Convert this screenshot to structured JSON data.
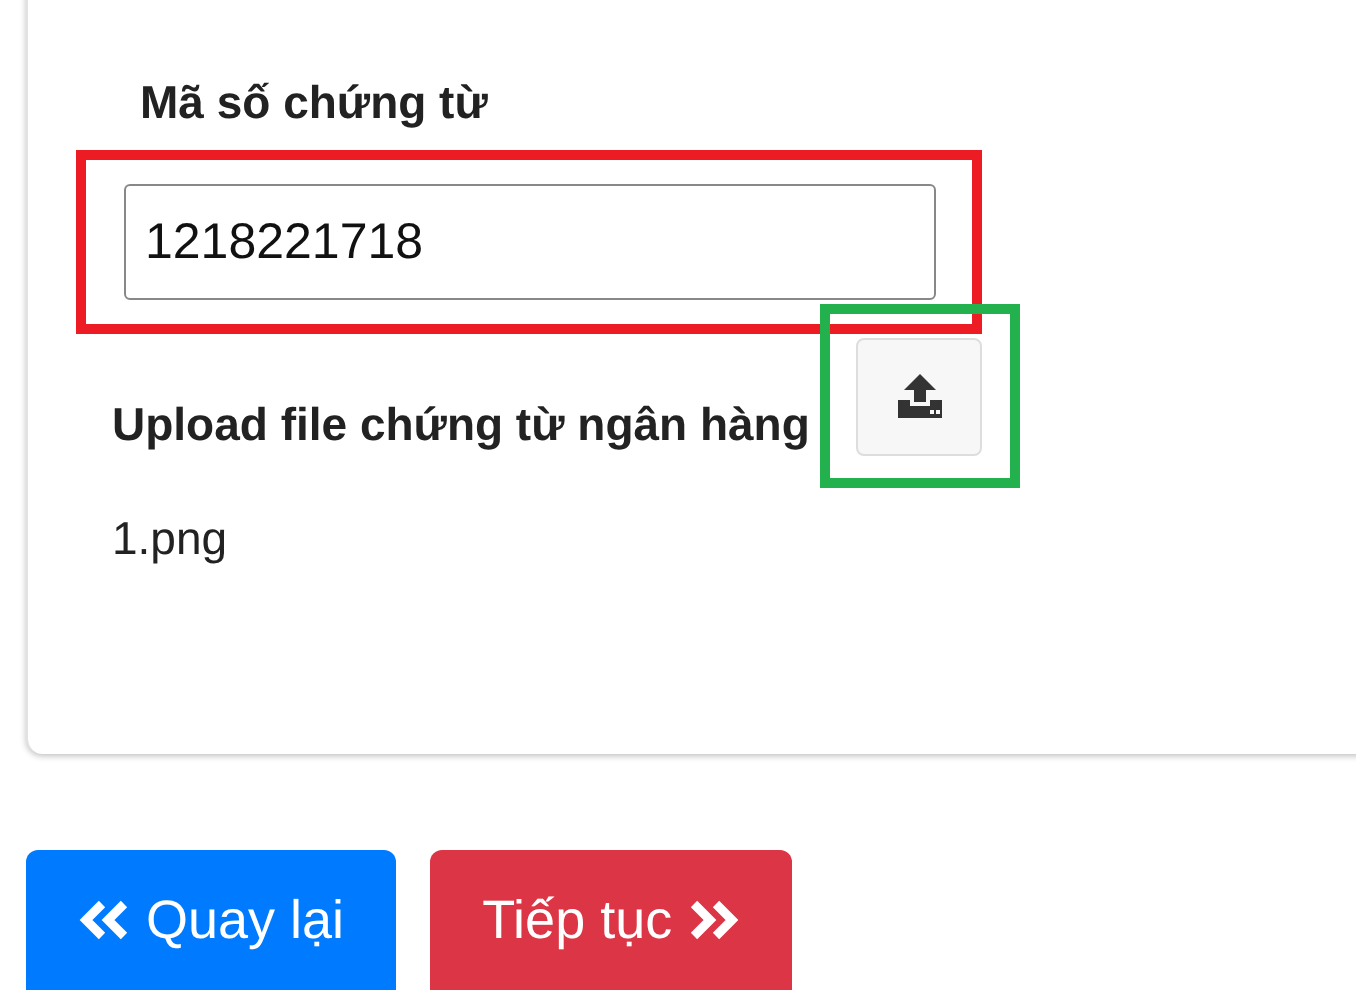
{
  "form": {
    "code_label": "Mã số chứng từ",
    "code_value": "1218221718",
    "upload_label": "Upload file chứng từ ngân hàng",
    "file_name": "1.png"
  },
  "annotations": [
    {
      "kind": "field",
      "color": "#ed1c24"
    },
    {
      "kind": "upload",
      "color": "#22b14c"
    }
  ],
  "buttons": [
    {
      "label": "Quay lại",
      "kind": "back"
    },
    {
      "label": "Tiếp tục",
      "kind": "next"
    }
  ]
}
